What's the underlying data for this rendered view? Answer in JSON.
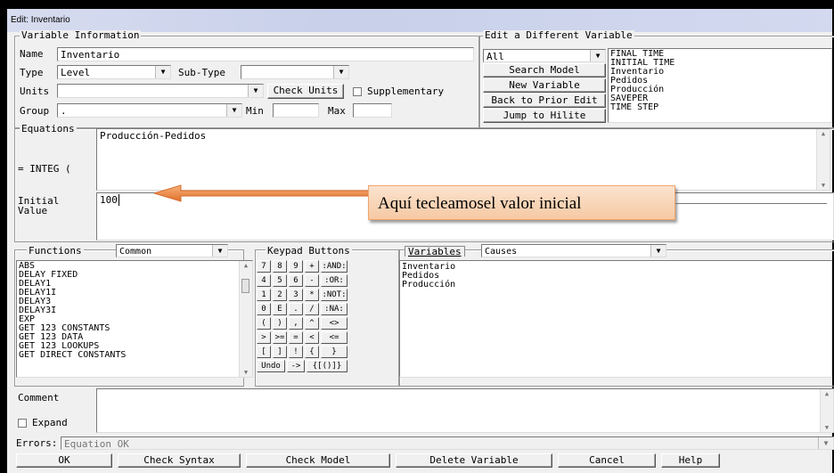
{
  "window": {
    "title": "Edit: Inventario"
  },
  "variable_info": {
    "legend": "Variable Information",
    "name_label": "Name",
    "name_value": "Inventario",
    "type_label": "Type",
    "type_value": "Level",
    "subtype_label": "Sub-Type",
    "subtype_value": "",
    "units_label": "Units",
    "units_value": "",
    "check_units_label": "Check Units",
    "supplementary_label": "Supplementary",
    "group_label": "Group",
    "group_value": ".",
    "min_label": "Min",
    "min_value": "",
    "max_label": "Max",
    "max_value": ""
  },
  "edit_different": {
    "legend": "Edit a Different Variable",
    "filter_value": "All",
    "search_model": "Search Model",
    "new_variable": "New Variable",
    "back_to_prior": "Back to Prior Edit",
    "jump_to_hilite": "Jump to Hilite",
    "variables": [
      "FINAL TIME",
      "INITIAL TIME",
      "Inventario",
      "Pedidos",
      "Producción",
      "SAVEPER",
      "TIME STEP"
    ]
  },
  "equations": {
    "legend": "Equations",
    "integ_label": "= INTEG (",
    "equation_value": "Producción-Pedidos",
    "initial_label_1": "Initial",
    "initial_label_2": "Value",
    "initial_value": "100"
  },
  "annotation": {
    "text": "Aquí tecleamosel valor inicial"
  },
  "functions": {
    "legend": "Functions",
    "category": "Common",
    "items": [
      "ABS",
      "DELAY FIXED",
      "DELAY1",
      "DELAY1I",
      "DELAY3",
      "DELAY3I",
      "EXP",
      "GET 123 CONSTANTS",
      "GET 123 DATA",
      "GET 123 LOOKUPS",
      "GET DIRECT CONSTANTS"
    ]
  },
  "keypad": {
    "legend": "Keypad Buttons",
    "rows": [
      [
        "7",
        "8",
        "9",
        "+",
        ":AND:"
      ],
      [
        "4",
        "5",
        "6",
        "-",
        ":OR:"
      ],
      [
        "1",
        "2",
        "3",
        "*",
        ":NOT:"
      ],
      [
        "0",
        "E",
        ".",
        "/",
        ":NA:"
      ],
      [
        "(",
        ")",
        ",",
        "^",
        "<>"
      ],
      [
        ">",
        ">=",
        "=",
        "<",
        "<="
      ],
      [
        "[",
        "]",
        "!",
        "{",
        "}"
      ]
    ],
    "undo": "Undo",
    "arrow": "->",
    "braces": "{[()]}"
  },
  "variables_panel": {
    "tab_label": "Variables",
    "dropdown": "Causes",
    "items": [
      "Inventario",
      "Pedidos",
      "Producción"
    ]
  },
  "comment": {
    "label": "Comment",
    "value": "",
    "expand_label": "Expand"
  },
  "errors": {
    "label": "Errors:",
    "value": "Equation OK"
  },
  "bottom_buttons": {
    "ok": "OK",
    "check_syntax": "Check Syntax",
    "check_model": "Check Model",
    "delete_variable": "Delete Variable",
    "cancel": "Cancel",
    "help": "Help"
  }
}
